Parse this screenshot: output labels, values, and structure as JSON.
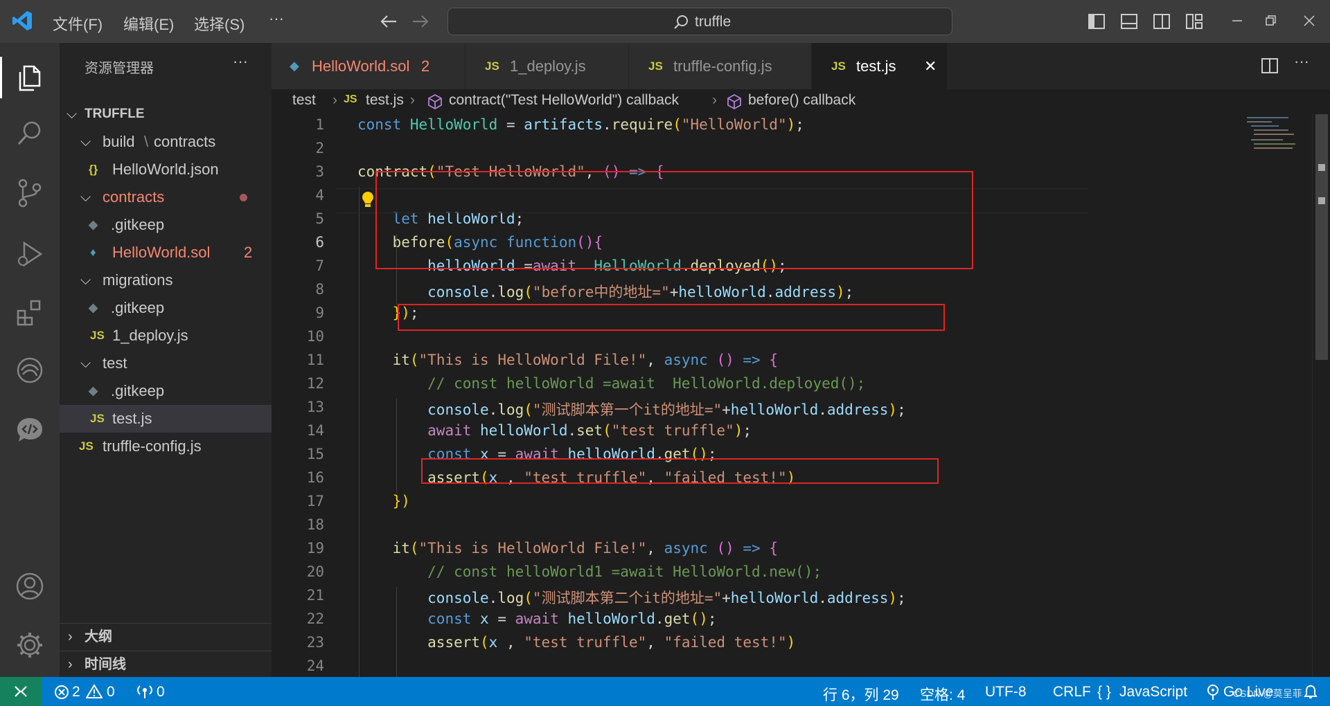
{
  "titlebar": {
    "menus": [
      "文件(F)",
      "编辑(E)",
      "选择(S)",
      "···"
    ],
    "search_text": "truffle"
  },
  "sidebar": {
    "title": "资源管理器",
    "more": "···",
    "root": "TRUFFLE",
    "items": [
      {
        "label": "build",
        "label2": "contracts",
        "type": "folder"
      },
      {
        "label": "HelloWorld.json",
        "icon": "{}",
        "type": "file"
      },
      {
        "label": "contracts",
        "type": "folder",
        "modified": true
      },
      {
        "label": ".gitkeep",
        "type": "file"
      },
      {
        "label": "HelloWorld.sol",
        "badge": "2",
        "type": "file"
      },
      {
        "label": "migrations",
        "type": "folder"
      },
      {
        "label": ".gitkeep",
        "type": "file"
      },
      {
        "label": "1_deploy.js",
        "icon": "JS",
        "type": "file"
      },
      {
        "label": "test",
        "type": "folder"
      },
      {
        "label": ".gitkeep",
        "type": "file"
      },
      {
        "label": "test.js",
        "icon": "JS",
        "type": "file",
        "selected": true
      },
      {
        "label": "truffle-config.js",
        "icon": "JS",
        "type": "file"
      }
    ],
    "sections": [
      "大纲",
      "时间线"
    ]
  },
  "tabs": [
    {
      "label": "HelloWorld.sol",
      "badge": "2",
      "icon": "◆"
    },
    {
      "label": "1_deploy.js",
      "icon": "JS"
    },
    {
      "label": "truffle-config.js",
      "icon": "JS"
    },
    {
      "label": "test.js",
      "icon": "JS",
      "active": true,
      "close": "✕"
    }
  ],
  "breadcrumbs": [
    "test",
    "test.js",
    "contract(\"Test HelloWorld\") callback",
    "before() callback"
  ],
  "editor": {
    "line_numbers": [
      "1",
      "2",
      "3",
      "4",
      "5",
      "6",
      "7",
      "8",
      "9",
      "10",
      "11",
      "12",
      "13",
      "14",
      "15",
      "16",
      "17",
      "18",
      "19",
      "20",
      "21",
      "22",
      "23",
      "24"
    ],
    "current_line": 6,
    "lines": [
      "const HelloWorld = artifacts.require(\"HelloWorld\");",
      "",
      "contract(\"Test HelloWorld\", () => {",
      "",
      "    let helloWorld;",
      "    before(async function(){",
      "        helloWorld =await  HelloWorld.deployed();",
      "        console.log(\"before中的地址=\"+helloWorld.address);",
      "    });",
      "",
      "    it(\"This is HelloWorld File!\", async () => {",
      "        // const helloWorld =await  HelloWorld.deployed();",
      "        console.log(\"测试脚本第一个it的地址=\"+helloWorld.address);",
      "        await helloWorld.set(\"test truffle\");",
      "        const x = await helloWorld.get();",
      "        assert(x , \"test truffle\", \"failed test!\")",
      "    })",
      "",
      "    it(\"This is HelloWorld File!\", async () => {",
      "        // const helloWorld1 =await HelloWorld.new();",
      "        console.log(\"测试脚本第二个it的地址=\"+helloWorld.address);",
      "        const x = await helloWorld.get();",
      "        assert(x , \"test truffle\", \"failed test!\")",
      ""
    ]
  },
  "statusbar": {
    "errors": "2",
    "warnings": "0",
    "ports": "0",
    "position": "行 6，列 29",
    "spaces": "空格: 4",
    "encoding": "UTF-8",
    "eol": "CRLF",
    "language": "JavaScript",
    "golive": "Go Live",
    "watermark": "CSDN @莫呈菲"
  }
}
